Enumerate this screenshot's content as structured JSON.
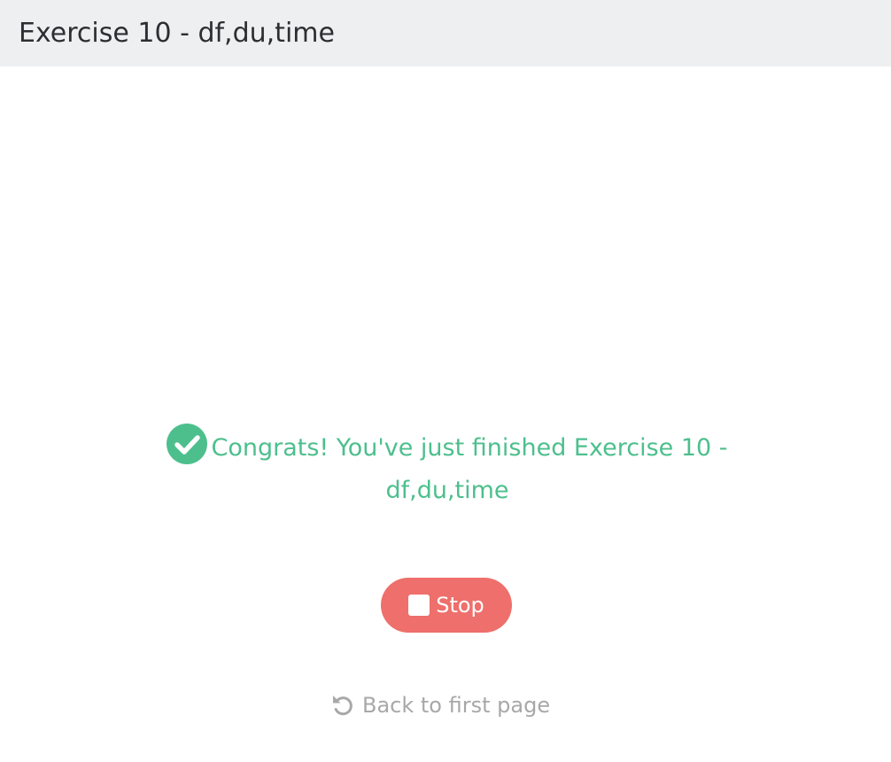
{
  "header": {
    "title": "Exercise 10 - df,du,time"
  },
  "result": {
    "message": "Congrats! You've just finished Exercise 10 - df,du,time",
    "icon": "check-circle-icon",
    "color": "#4dbf8d"
  },
  "actions": {
    "stop_label": "Stop",
    "stop_icon": "stop-icon",
    "stop_color": "#ee6f6b",
    "back_label": "Back to first page",
    "back_icon": "undo-icon",
    "back_color": "#a8a8a8"
  }
}
